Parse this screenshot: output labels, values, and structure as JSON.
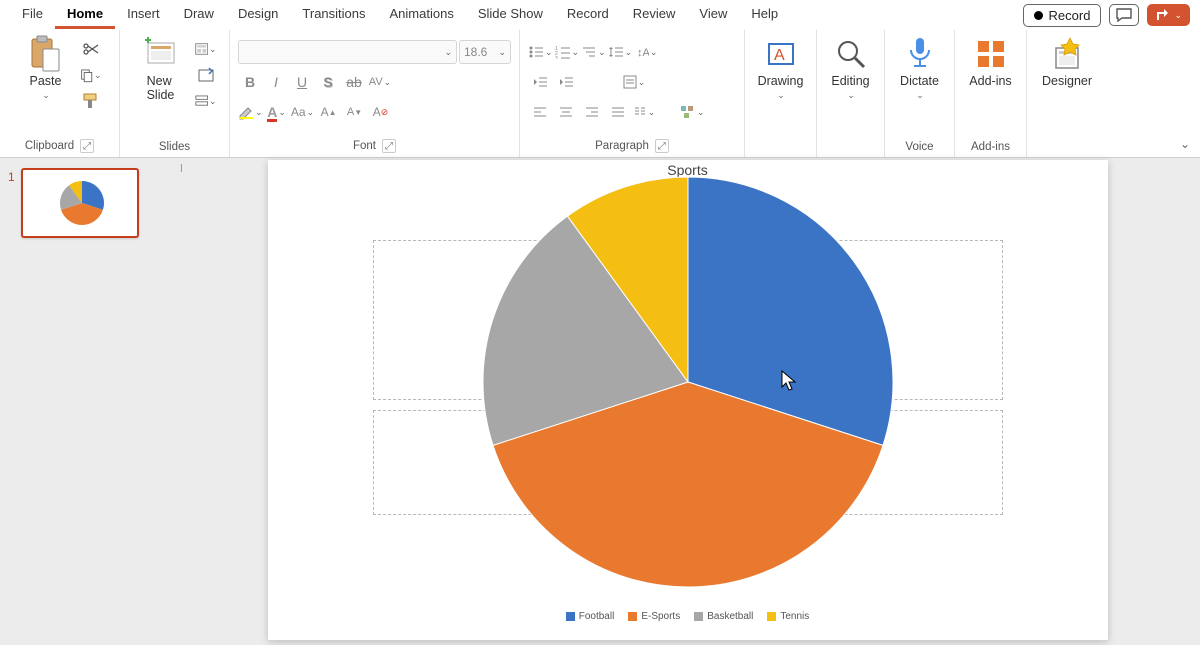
{
  "menu": {
    "tabs": [
      "File",
      "Home",
      "Insert",
      "Draw",
      "Design",
      "Transitions",
      "Animations",
      "Slide Show",
      "Record",
      "Review",
      "View",
      "Help"
    ],
    "active": "Home",
    "record": "Record"
  },
  "ribbon": {
    "clipboard": {
      "label": "Clipboard",
      "paste": "Paste"
    },
    "slides": {
      "label": "Slides",
      "newslide": "New\nSlide"
    },
    "font": {
      "label": "Font",
      "size": "18.6"
    },
    "paragraph": {
      "label": "Paragraph"
    },
    "drawing": {
      "label": "Drawing"
    },
    "editing": {
      "label": "Editing"
    },
    "voice": {
      "label": "Voice",
      "dictate": "Dictate"
    },
    "addins": {
      "label": "Add-ins",
      "btn": "Add-ins"
    },
    "designer": {
      "label": "Designer"
    }
  },
  "thumb": {
    "num": "1"
  },
  "chart_data": {
    "type": "pie",
    "title": "Sports",
    "series": [
      {
        "name": "Football",
        "value": 30,
        "color": "#3b74c4"
      },
      {
        "name": "E-Sports",
        "value": 40,
        "color": "#e9792f"
      },
      {
        "name": "Basketball",
        "value": 20,
        "color": "#a7a7a7"
      },
      {
        "name": "Tennis",
        "value": 10,
        "color": "#f4bf12"
      }
    ],
    "legend_position": "bottom"
  }
}
